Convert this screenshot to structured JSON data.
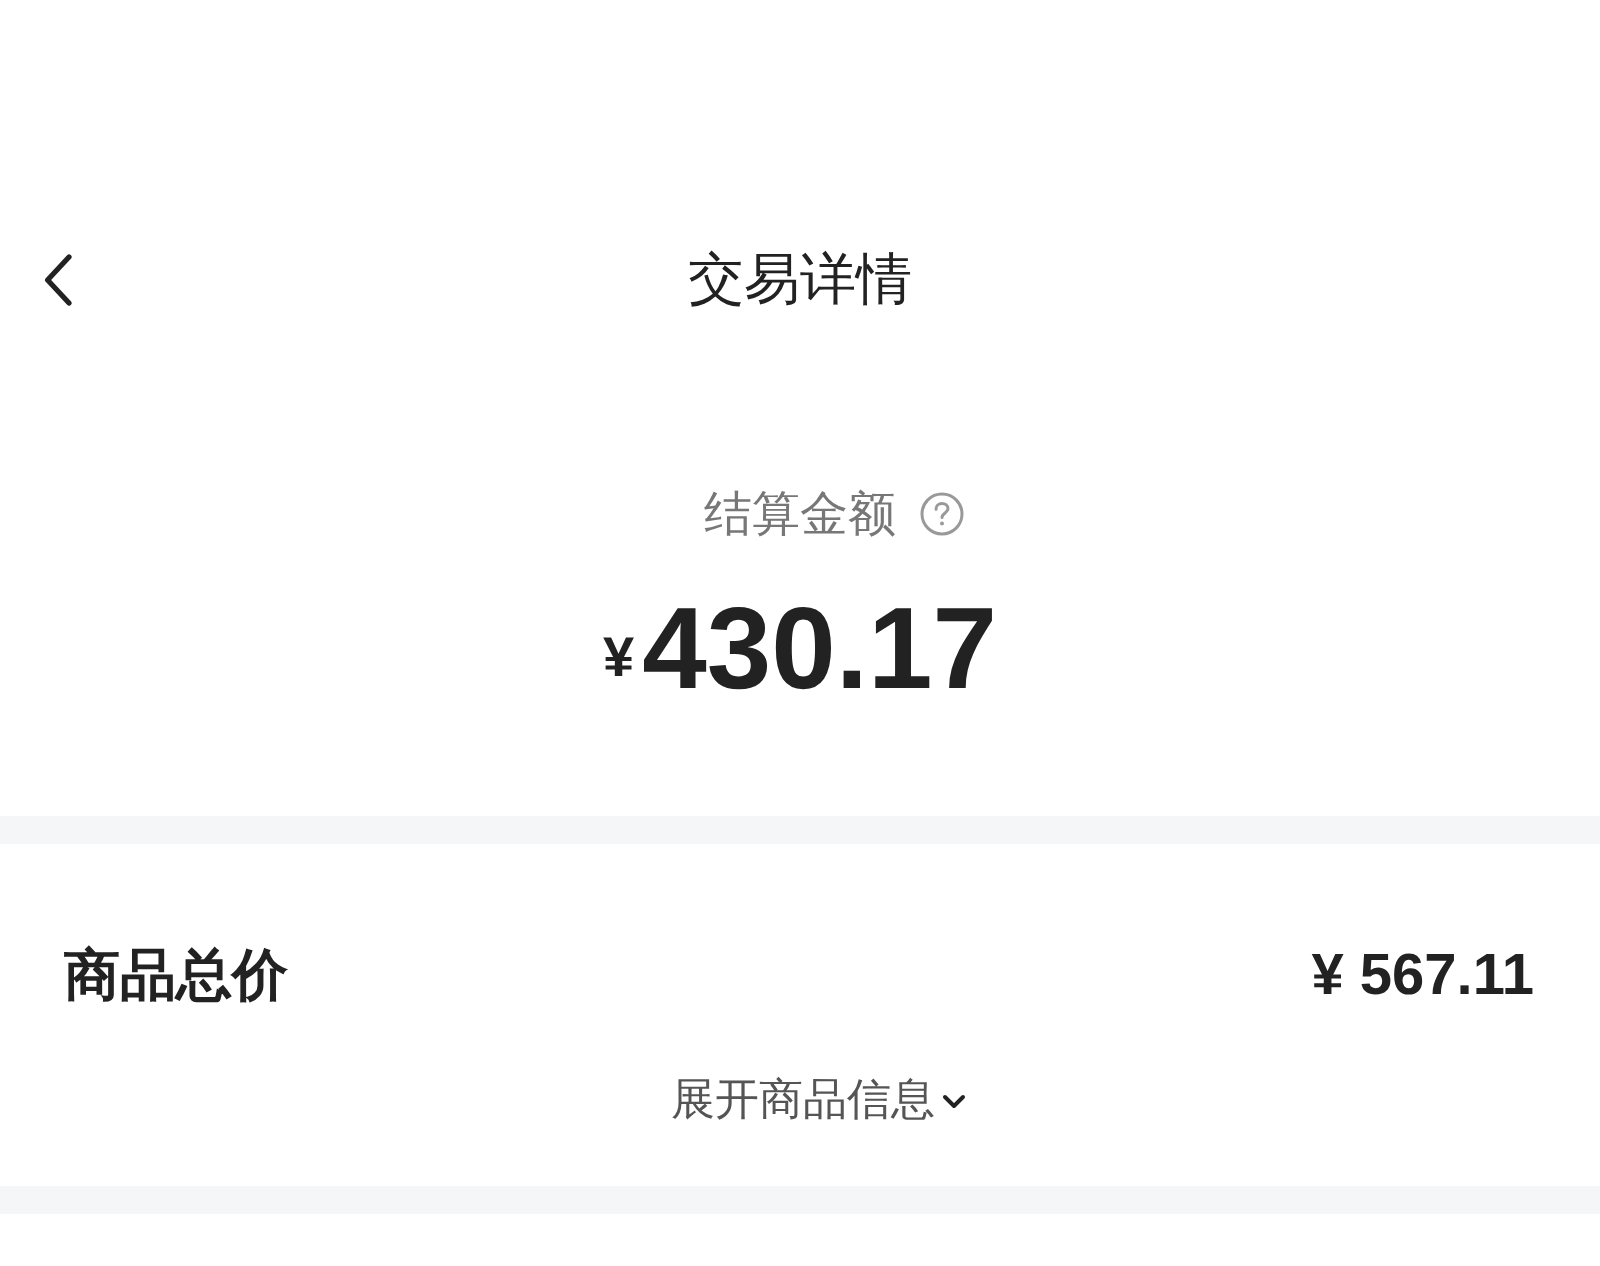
{
  "header": {
    "title": "交易详情"
  },
  "settlement": {
    "label": "结算金额",
    "currency": "¥",
    "amount": "430.17"
  },
  "goods": {
    "label": "商品总价",
    "price": "¥ 567.11",
    "expand_link": {
      "label": "展开商品信息",
      "expanded": false
    }
  }
}
